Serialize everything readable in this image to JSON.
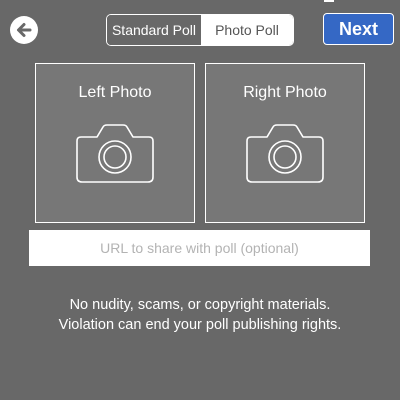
{
  "header": {
    "back_icon": "arrow-left-circle-icon",
    "segments": [
      {
        "label": "Standard Poll",
        "selected": false
      },
      {
        "label": "Photo Poll",
        "selected": true
      }
    ],
    "next_label": "Next"
  },
  "photos": {
    "left_label": "Left Photo",
    "right_label": "Right Photo",
    "icon": "camera-icon"
  },
  "url_field": {
    "placeholder": "URL to share with poll (optional)",
    "value": ""
  },
  "notice": {
    "line1": "No nudity, scams, or copyright materials.",
    "line2": "Violation can end your poll publishing rights."
  },
  "colors": {
    "background": "#686868",
    "accent": "#3568c5"
  }
}
